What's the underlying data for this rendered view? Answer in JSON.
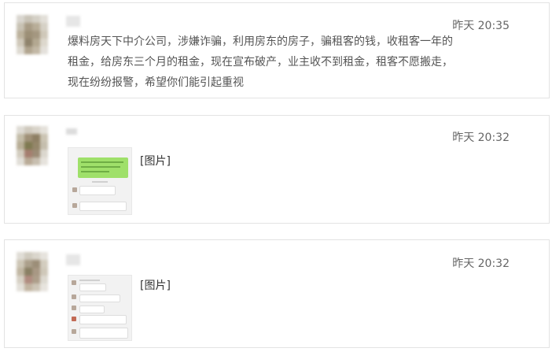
{
  "messages": [
    {
      "time": "昨天 20:35",
      "text": "爆料房天下中介公司，涉嫌诈骗，利用房东的房子，骗租客的钱，收租客一年的租金，给房东三个月的租金，现在宣布破产，业主收不到租金，租客不愿搬走，现在纷纷报警，希望你们能引起重视"
    },
    {
      "time": "昨天 20:32",
      "name": "...",
      "text": "[图片]"
    },
    {
      "time": "昨天 20:32",
      "text": "[图片]"
    }
  ],
  "colors": {
    "wechat_green": "#9fe06a",
    "card_border": "#e3e3e3",
    "time_text": "#666666"
  },
  "icons": [
    "avatar-blurred",
    "image-thumbnail"
  ]
}
